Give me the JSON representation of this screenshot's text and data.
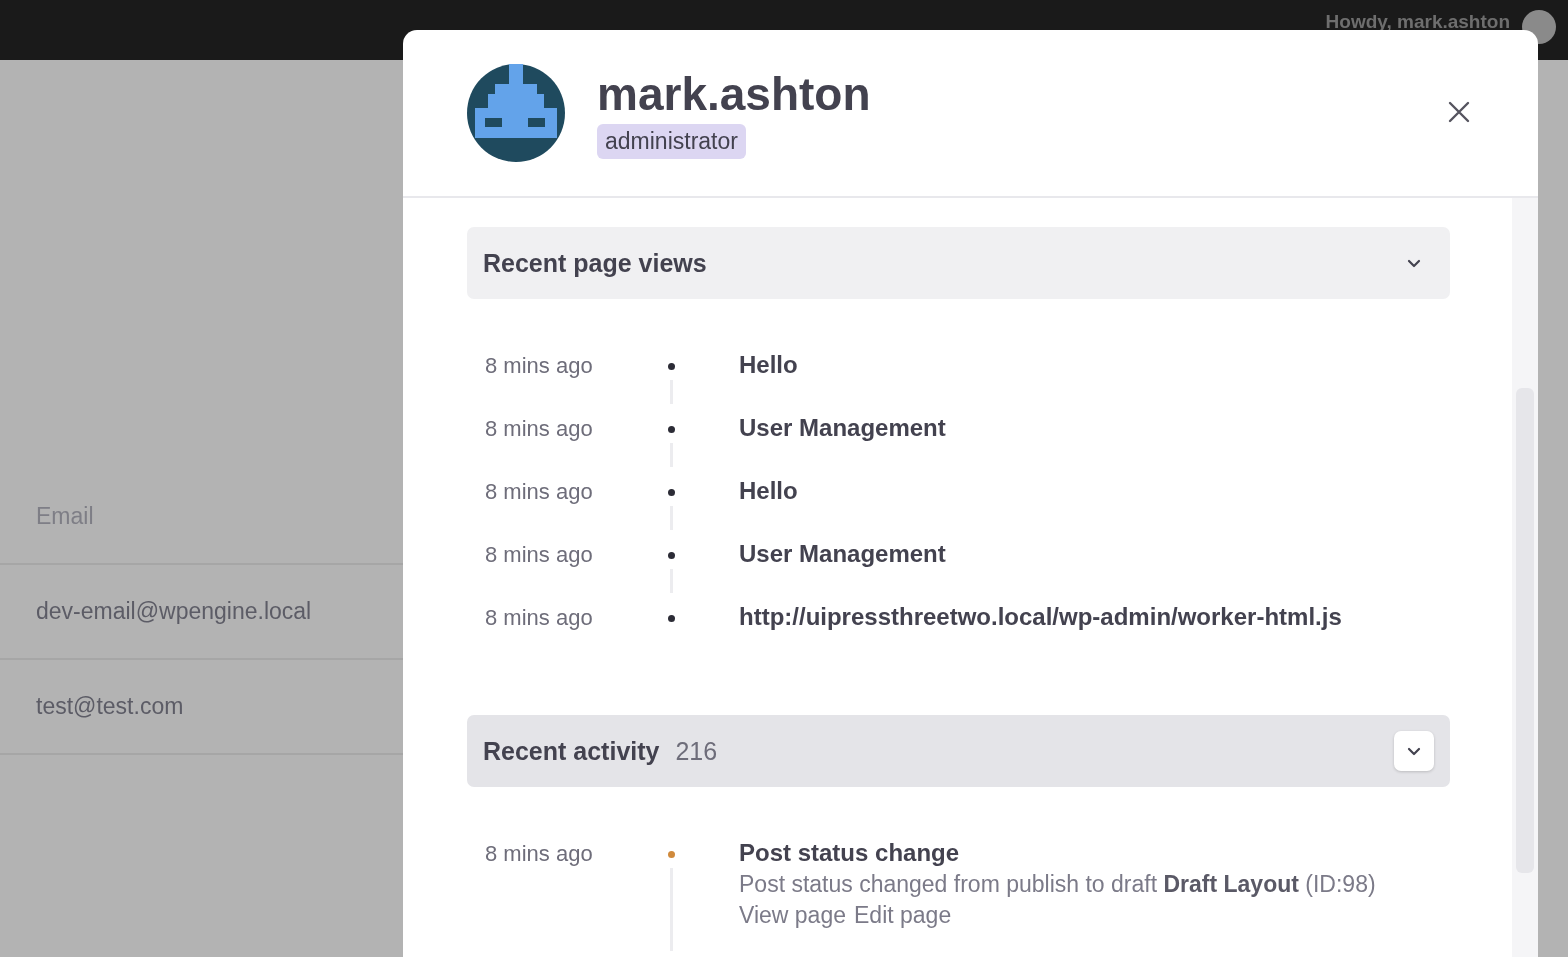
{
  "top_bar": {
    "greeting": "Howdy, mark.ashton"
  },
  "background_table": {
    "column": "Email",
    "rows": [
      "dev-email@wpengine.local",
      "test@test.com"
    ]
  },
  "modal": {
    "username": "mark.ashton",
    "role": "administrator",
    "sections": [
      {
        "title": "Recent page views",
        "focused": false,
        "kind": "views",
        "items": [
          {
            "time": "8 mins ago",
            "title": "Hello",
            "color": "#2c2c36"
          },
          {
            "time": "8 mins ago",
            "title": "User Management",
            "color": "#2c2c36"
          },
          {
            "time": "8 mins ago",
            "title": "Hello",
            "color": "#2c2c36"
          },
          {
            "time": "8 mins ago",
            "title": "User Management",
            "color": "#2c2c36"
          },
          {
            "time": "8 mins ago",
            "title": "http://uipressthreetwo.local/wp-admin/worker-html.js",
            "color": "#2c2c36"
          }
        ]
      },
      {
        "title": "Recent activity",
        "count": "216",
        "focused": true,
        "kind": "activity",
        "items": [
          {
            "time": "8 mins ago",
            "title": "Post status change",
            "color": "#d08a3c",
            "description": "Post status changed from publish to draft **Draft Layout** (ID:98)",
            "links": [
              "View page",
              "Edit page"
            ]
          }
        ]
      }
    ]
  }
}
